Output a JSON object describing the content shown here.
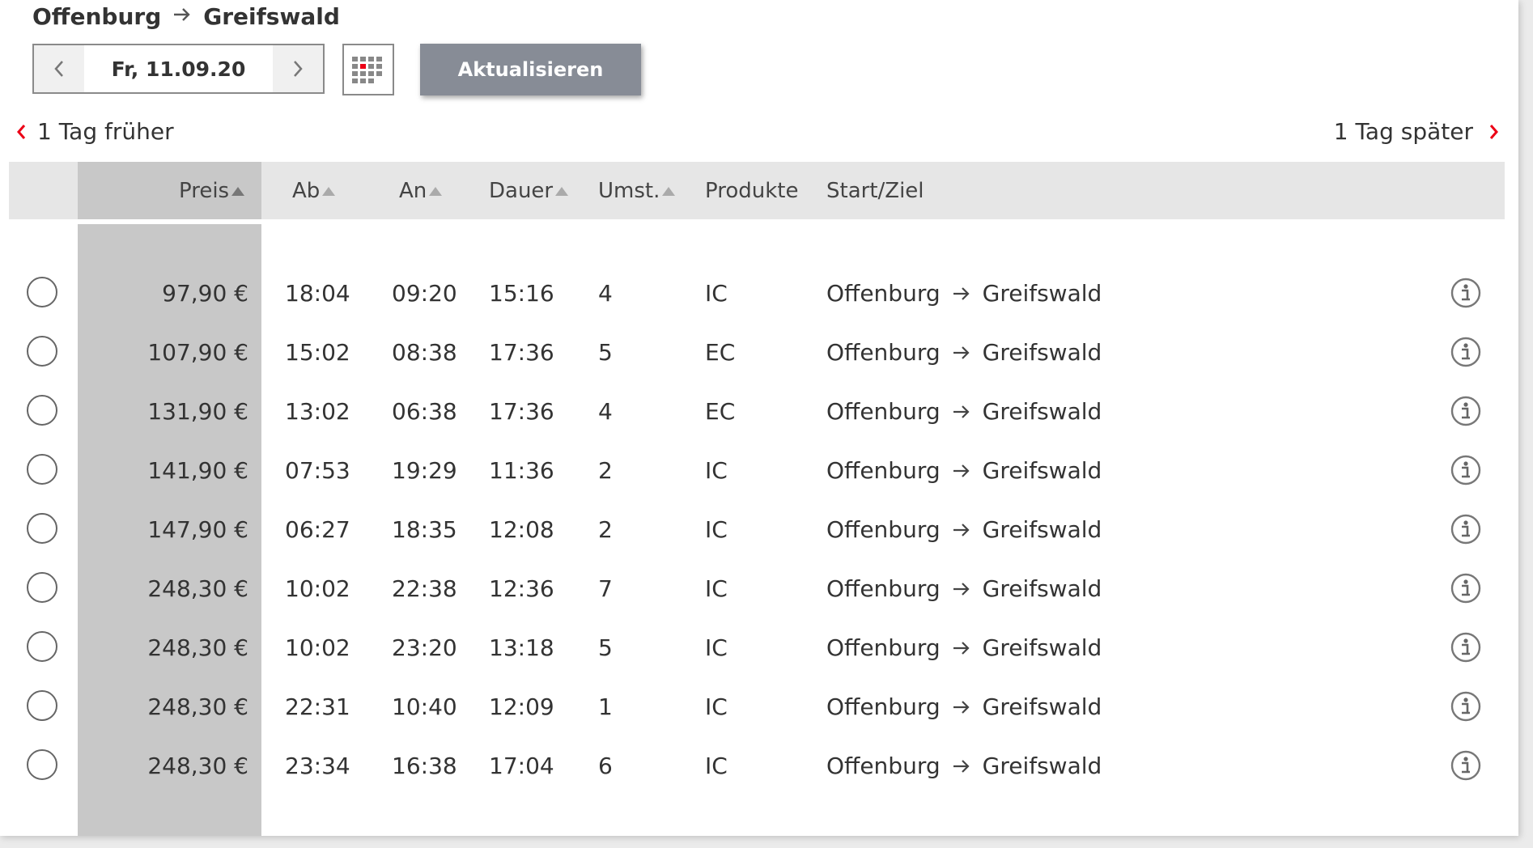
{
  "header": {
    "origin": "Offenburg",
    "destination": "Greifswald"
  },
  "date_picker": {
    "value": "Fr, 11.09.20"
  },
  "update_button": "Aktualisieren",
  "nav": {
    "earlier": "1 Tag früher",
    "later": "1 Tag später"
  },
  "table": {
    "columns": {
      "price": "Preis",
      "departure": "Ab",
      "arrival": "An",
      "duration": "Dauer",
      "transfers": "Umst.",
      "products": "Produkte",
      "route": "Start/Ziel"
    },
    "rows": [
      {
        "price": "97,90 €",
        "dep": "18:04",
        "arr": "09:20",
        "dur": "15:16",
        "transfers": "4",
        "product": "IC",
        "from": "Offenburg",
        "to": "Greifswald"
      },
      {
        "price": "107,90 €",
        "dep": "15:02",
        "arr": "08:38",
        "dur": "17:36",
        "transfers": "5",
        "product": "EC",
        "from": "Offenburg",
        "to": "Greifswald"
      },
      {
        "price": "131,90 €",
        "dep": "13:02",
        "arr": "06:38",
        "dur": "17:36",
        "transfers": "4",
        "product": "EC",
        "from": "Offenburg",
        "to": "Greifswald"
      },
      {
        "price": "141,90 €",
        "dep": "07:53",
        "arr": "19:29",
        "dur": "11:36",
        "transfers": "2",
        "product": "IC",
        "from": "Offenburg",
        "to": "Greifswald"
      },
      {
        "price": "147,90 €",
        "dep": "06:27",
        "arr": "18:35",
        "dur": "12:08",
        "transfers": "2",
        "product": "IC",
        "from": "Offenburg",
        "to": "Greifswald"
      },
      {
        "price": "248,30 €",
        "dep": "10:02",
        "arr": "22:38",
        "dur": "12:36",
        "transfers": "7",
        "product": "IC",
        "from": "Offenburg",
        "to": "Greifswald"
      },
      {
        "price": "248,30 €",
        "dep": "10:02",
        "arr": "23:20",
        "dur": "13:18",
        "transfers": "5",
        "product": "IC",
        "from": "Offenburg",
        "to": "Greifswald"
      },
      {
        "price": "248,30 €",
        "dep": "22:31",
        "arr": "10:40",
        "dur": "12:09",
        "transfers": "1",
        "product": "IC",
        "from": "Offenburg",
        "to": "Greifswald"
      },
      {
        "price": "248,30 €",
        "dep": "23:34",
        "arr": "16:38",
        "dur": "17:04",
        "transfers": "6",
        "product": "IC",
        "from": "Offenburg",
        "to": "Greifswald"
      }
    ]
  },
  "colors": {
    "accent_red": "#ec0016",
    "button_gray": "#878c96",
    "header_gray": "#e6e6e6",
    "sorted_column_gray": "#c8c8c8"
  }
}
